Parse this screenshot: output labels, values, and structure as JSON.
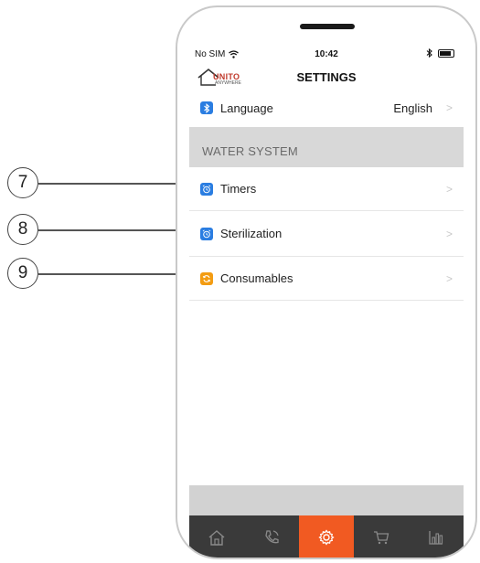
{
  "callouts": [
    {
      "number": "7"
    },
    {
      "number": "8"
    },
    {
      "number": "9"
    }
  ],
  "status": {
    "carrier": "No SIM",
    "time": "10:42"
  },
  "header": {
    "logo_text": "UNITO",
    "logo_subtext": "ANYWHERE",
    "title": "SETTINGS"
  },
  "rows": {
    "language": {
      "label": "Language",
      "value": "English",
      "icon": "bluetooth-icon"
    },
    "timers": {
      "label": "Timers",
      "icon": "alarm-clock-icon"
    },
    "sterilization": {
      "label": "Sterilization",
      "icon": "alarm-clock-icon"
    },
    "consumables": {
      "label": "Consumables",
      "icon": "refresh-icon"
    }
  },
  "section": {
    "water_system": "WATER SYSTEM"
  },
  "tabs": [
    {
      "name": "home-icon",
      "active": false
    },
    {
      "name": "phone-icon",
      "active": false
    },
    {
      "name": "settings-gear-icon",
      "active": true
    },
    {
      "name": "cart-icon",
      "active": false
    },
    {
      "name": "bar-chart-icon",
      "active": false
    }
  ],
  "colors": {
    "accent_orange": "#f15a22",
    "icon_blue": "#2a7de1",
    "icon_orange": "#f39c12",
    "tabbar_bg": "#3a3a3a",
    "section_bg": "#d8d8d8"
  }
}
